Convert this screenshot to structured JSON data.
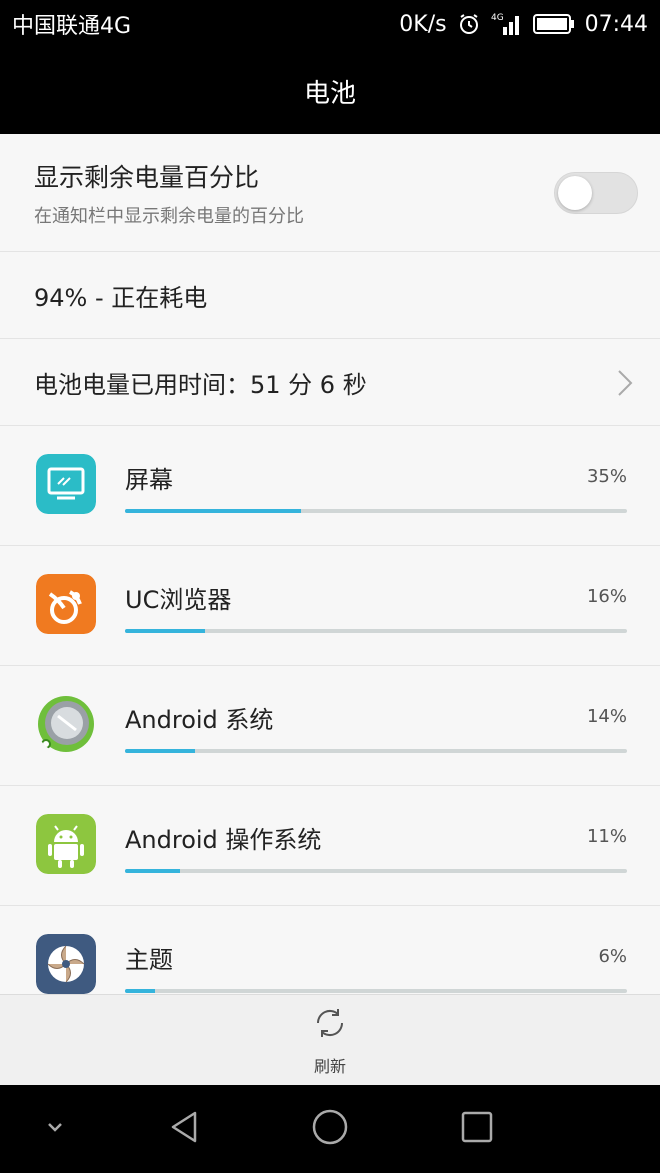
{
  "status_bar": {
    "carrier": "中国联通4G",
    "net_speed": "0K/s",
    "signal_label": "4G",
    "time": "07:44"
  },
  "title": "电池",
  "toggle_row": {
    "label": "显示剩余电量百分比",
    "sublabel": "在通知栏中显示剩余电量的百分比",
    "enabled": false
  },
  "battery_status": "94% - 正在耗电",
  "usage_time": "电池电量已用时间：51 分 6 秒",
  "apps": [
    {
      "name": "屏幕",
      "percent": "35%",
      "value": 35,
      "icon": "screen-icon",
      "color": "#2bbcc7"
    },
    {
      "name": "UC浏览器",
      "percent": "16%",
      "value": 16,
      "icon": "uc-browser-icon",
      "color": "#f07a20"
    },
    {
      "name": "Android 系统",
      "percent": "14%",
      "value": 14,
      "icon": "android-system-icon",
      "color": "#6fbf3b"
    },
    {
      "name": "Android 操作系统",
      "percent": "11%",
      "value": 11,
      "icon": "android-os-icon",
      "color": "#8dc63f"
    },
    {
      "name": "主题",
      "percent": "6%",
      "value": 6,
      "icon": "theme-icon",
      "color": "#3f5a80"
    }
  ],
  "refresh_label": "刷新",
  "colors": {
    "accent": "#35b4dc",
    "track": "#d0d6d6"
  }
}
